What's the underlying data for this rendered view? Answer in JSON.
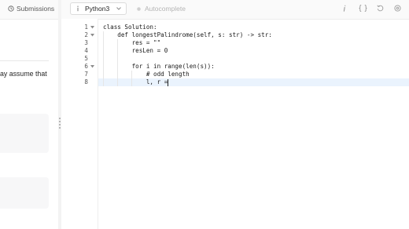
{
  "left_panel": {
    "submissions_label": "Submissions",
    "description_fragment": "ay assume that"
  },
  "editor_header": {
    "language": "Python3",
    "autocomplete_label": "Autocomplete",
    "icons": [
      "info-icon",
      "braces-icon",
      "reset-icon",
      "settings-icon"
    ]
  },
  "editor": {
    "line_numbers": [
      "1",
      "2",
      "3",
      "4",
      "5",
      "6",
      "7",
      "8"
    ],
    "fold_markers_on_lines": [
      1,
      2,
      6
    ],
    "code_lines": [
      "class Solution:",
      "    def longestPalindrome(self, s: str) -> str:",
      "        res = \"\"",
      "        resLen = 0",
      "",
      "        for i in range(len(s)):",
      "            # odd length",
      "            l, r ="
    ],
    "active_line": 8
  },
  "colors": {
    "active_line_bg": "#eaf3fd",
    "panel_bg": "#fafafa",
    "border": "#ececec"
  }
}
